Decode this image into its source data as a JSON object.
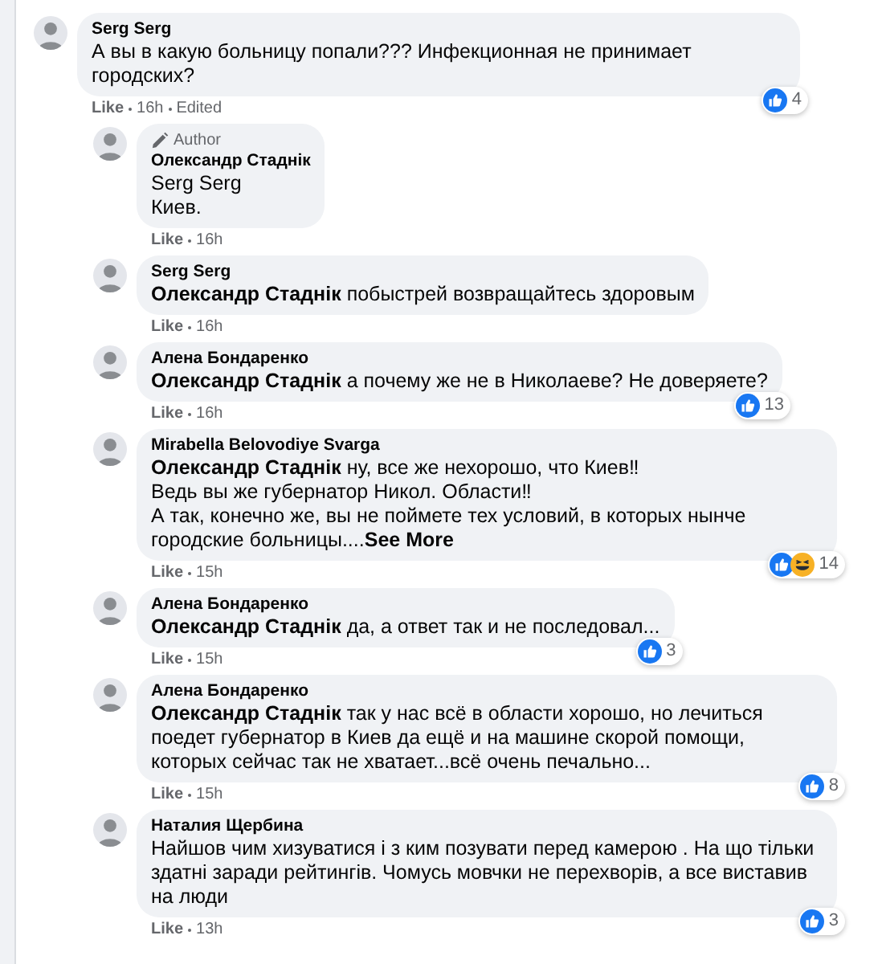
{
  "comments": [
    {
      "author": "Serg Serg",
      "text": "А вы в какую больницу попали??? Инфекционная не принимает городских?",
      "reactions": {
        "icons": [
          {
            "kind": "like"
          }
        ],
        "count": "4"
      },
      "meta": [
        "Like",
        "16h",
        "Edited"
      ],
      "children": [
        {
          "badge": "Author",
          "author": "Олександр Стаднік",
          "text": "Serg Serg\nКиев.",
          "meta": [
            "Like",
            "16h"
          ]
        },
        {
          "author": "Serg Serg",
          "text": "**Олександр Стаднік** побыстрей возвращайтесь здоровым",
          "meta": [
            "Like",
            "16h"
          ]
        },
        {
          "author": "Алена Бондаренко",
          "text": "**Олександр Стаднік** а почему же не в Николаеве? Не доверяете?",
          "reactions": {
            "icons": [
              {
                "kind": "like"
              }
            ],
            "count": "13"
          },
          "meta": [
            "Like",
            "16h"
          ]
        },
        {
          "author": "Mirabella Belovodiye Svarga",
          "text": "**Олександр Стаднік** ну, все же нехорошо, что Киев‼\nВедь вы же губернатор Никол. Области‼\nА так, конечно же, вы не поймете тех условий, в которых нынче городские больницы....",
          "see_more": "See More",
          "reactions": {
            "icons": [
              {
                "kind": "like"
              },
              {
                "kind": "haha"
              }
            ],
            "count": "14"
          },
          "meta": [
            "Like",
            "15h"
          ]
        },
        {
          "author": "Алена Бондаренко",
          "text": "**Олександр Стаднік** да, а ответ так и не последовал...",
          "reactions": {
            "icons": [
              {
                "kind": "like"
              }
            ],
            "count": "3"
          },
          "meta": [
            "Like",
            "15h"
          ]
        },
        {
          "author": "Алена Бондаренко",
          "text": "**Олександр Стаднік** так у нас всё в области хорошо, но лечиться поедет губернатор в Киев да ещё и на машине скорой помощи, которых сейчас так не хватает...всё очень печально...",
          "reactions": {
            "icons": [
              {
                "kind": "like"
              }
            ],
            "count": "8"
          },
          "meta": [
            "Like",
            "15h"
          ]
        },
        {
          "author": "Наталия Щербина",
          "text": "Найшов чим хизуватися і з ким позувати перед камерою . На що тільки здатні заради рейтингів. Чомусь мовчки не перехворів, а все виставив на люди",
          "reactions": {
            "icons": [
              {
                "kind": "like"
              }
            ],
            "count": "3"
          },
          "meta": [
            "Like",
            "13h"
          ]
        }
      ]
    }
  ]
}
